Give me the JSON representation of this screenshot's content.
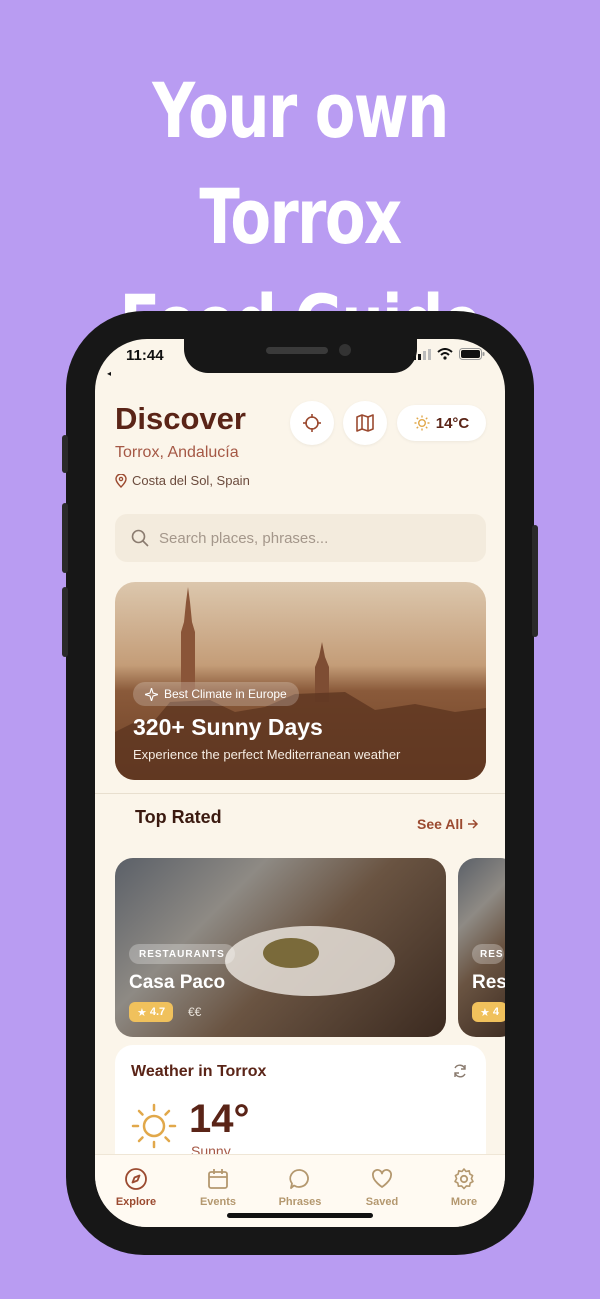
{
  "promo": {
    "line1": "Your own Torrox",
    "line2": "Food Guide"
  },
  "status": {
    "time": "11:44",
    "back": "◂"
  },
  "header": {
    "title": "Discover",
    "subtitle": "Torrox, Andalucía",
    "location": "Costa del Sol, Spain",
    "temperature": "14°C"
  },
  "search": {
    "placeholder": "Search places, phrases..."
  },
  "hero": {
    "badge": "Best Climate in Europe",
    "title": "320+ Sunny Days",
    "text": "Experience the perfect Mediterranean weather"
  },
  "top_rated": {
    "title": "Top Rated",
    "see_all": "See All",
    "cards": [
      {
        "category": "RESTAURANTS",
        "name": "Casa Paco",
        "rating": "4.7",
        "price": "€€"
      },
      {
        "category": "RES",
        "name": "Res",
        "rating": "4"
      }
    ]
  },
  "weather": {
    "title": "Weather in Torrox",
    "temp": "14°",
    "condition": "Sunny"
  },
  "tabs": [
    {
      "label": "Explore",
      "icon": "compass-icon",
      "active": true
    },
    {
      "label": "Events",
      "icon": "calendar-icon"
    },
    {
      "label": "Phrases",
      "icon": "chat-bubble-icon"
    },
    {
      "label": "Saved",
      "icon": "heart-icon"
    },
    {
      "label": "More",
      "icon": "gear-icon"
    }
  ],
  "colors": {
    "background": "#b99cf2",
    "brand": "#5a2417",
    "accent": "#9b4a30",
    "rating": "#f0c15c"
  }
}
